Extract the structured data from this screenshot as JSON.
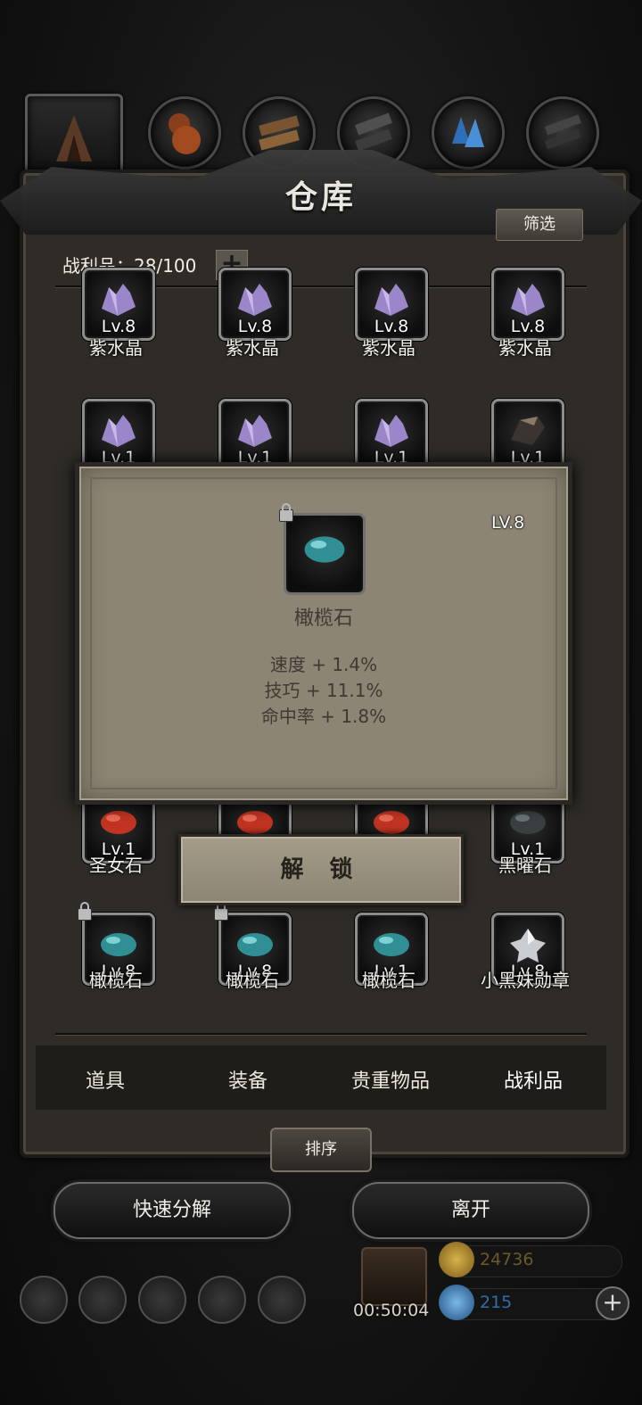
{
  "window": {
    "title": "仓库"
  },
  "categories": [
    {
      "icon": "hooded-figure-icon"
    },
    {
      "icon": "gourd-icon"
    },
    {
      "icon": "wood-plank-icon"
    },
    {
      "icon": "metal-ingot-icon"
    },
    {
      "icon": "blue-crystal-icon"
    },
    {
      "icon": "dark-metal-icon"
    }
  ],
  "header": {
    "filter_label": "筛选",
    "loot_count_label": "战利品：28/100",
    "plus_label": "+"
  },
  "items_row1": [
    {
      "name": "紫水晶",
      "level": "Lv.8",
      "icon": "amethyst-icon"
    },
    {
      "name": "紫水晶",
      "level": "Lv.8",
      "icon": "amethyst-icon"
    },
    {
      "name": "紫水晶",
      "level": "Lv.8",
      "icon": "amethyst-icon"
    },
    {
      "name": "紫水晶",
      "level": "Lv.8",
      "icon": "amethyst-icon"
    }
  ],
  "items_row2": [
    {
      "level": "Lv.1",
      "icon": "amethyst-icon"
    },
    {
      "level": "Lv.1",
      "icon": "amethyst-icon"
    },
    {
      "level": "Lv.1",
      "icon": "amethyst-icon"
    },
    {
      "level": "Lv.1",
      "icon": "dark-rock-icon"
    }
  ],
  "items_row4": [
    {
      "name": "圣女石",
      "level": "Lv.1",
      "icon": "red-stone-icon"
    },
    {
      "icon": "red-stone-icon"
    },
    {
      "icon": "red-stone-icon"
    },
    {
      "name": "黑曜石",
      "level": "Lv.1",
      "icon": "obsidian-icon"
    }
  ],
  "items_row5": [
    {
      "name": "橄榄石",
      "level": "Lv.8",
      "icon": "olivine-icon",
      "locked": true
    },
    {
      "name": "橄榄石",
      "level": "Lv.8",
      "icon": "olivine-icon",
      "locked": true
    },
    {
      "name": "橄榄石",
      "level": "Lv.1",
      "icon": "olivine-icon",
      "locked": false
    },
    {
      "name": "小黑妹勋章",
      "level": "Lv.8",
      "icon": "silver-medal-icon",
      "locked": false
    }
  ],
  "popup": {
    "name": "橄榄石",
    "level": "LV.8",
    "locked": true,
    "stats": [
      "速度 + 1.4%",
      "技巧 + 11.1%",
      "命中率 + 1.8%"
    ],
    "unlock_label": "解 锁"
  },
  "tabs": [
    {
      "label": "道具"
    },
    {
      "label": "装备"
    },
    {
      "label": "贵重物品"
    },
    {
      "label": "战利品",
      "active": true
    }
  ],
  "sort_label": "排序",
  "actions": {
    "quick_decompose": "快速分解",
    "leave": "离开"
  },
  "footer": {
    "timer": "00:50:04",
    "gold": "24736",
    "gems": "215"
  },
  "colors": {
    "panel": "#2f2c27",
    "popup": "#8c8574",
    "gold_text": "#6b5a28",
    "gem_text": "#2f6fa8"
  }
}
